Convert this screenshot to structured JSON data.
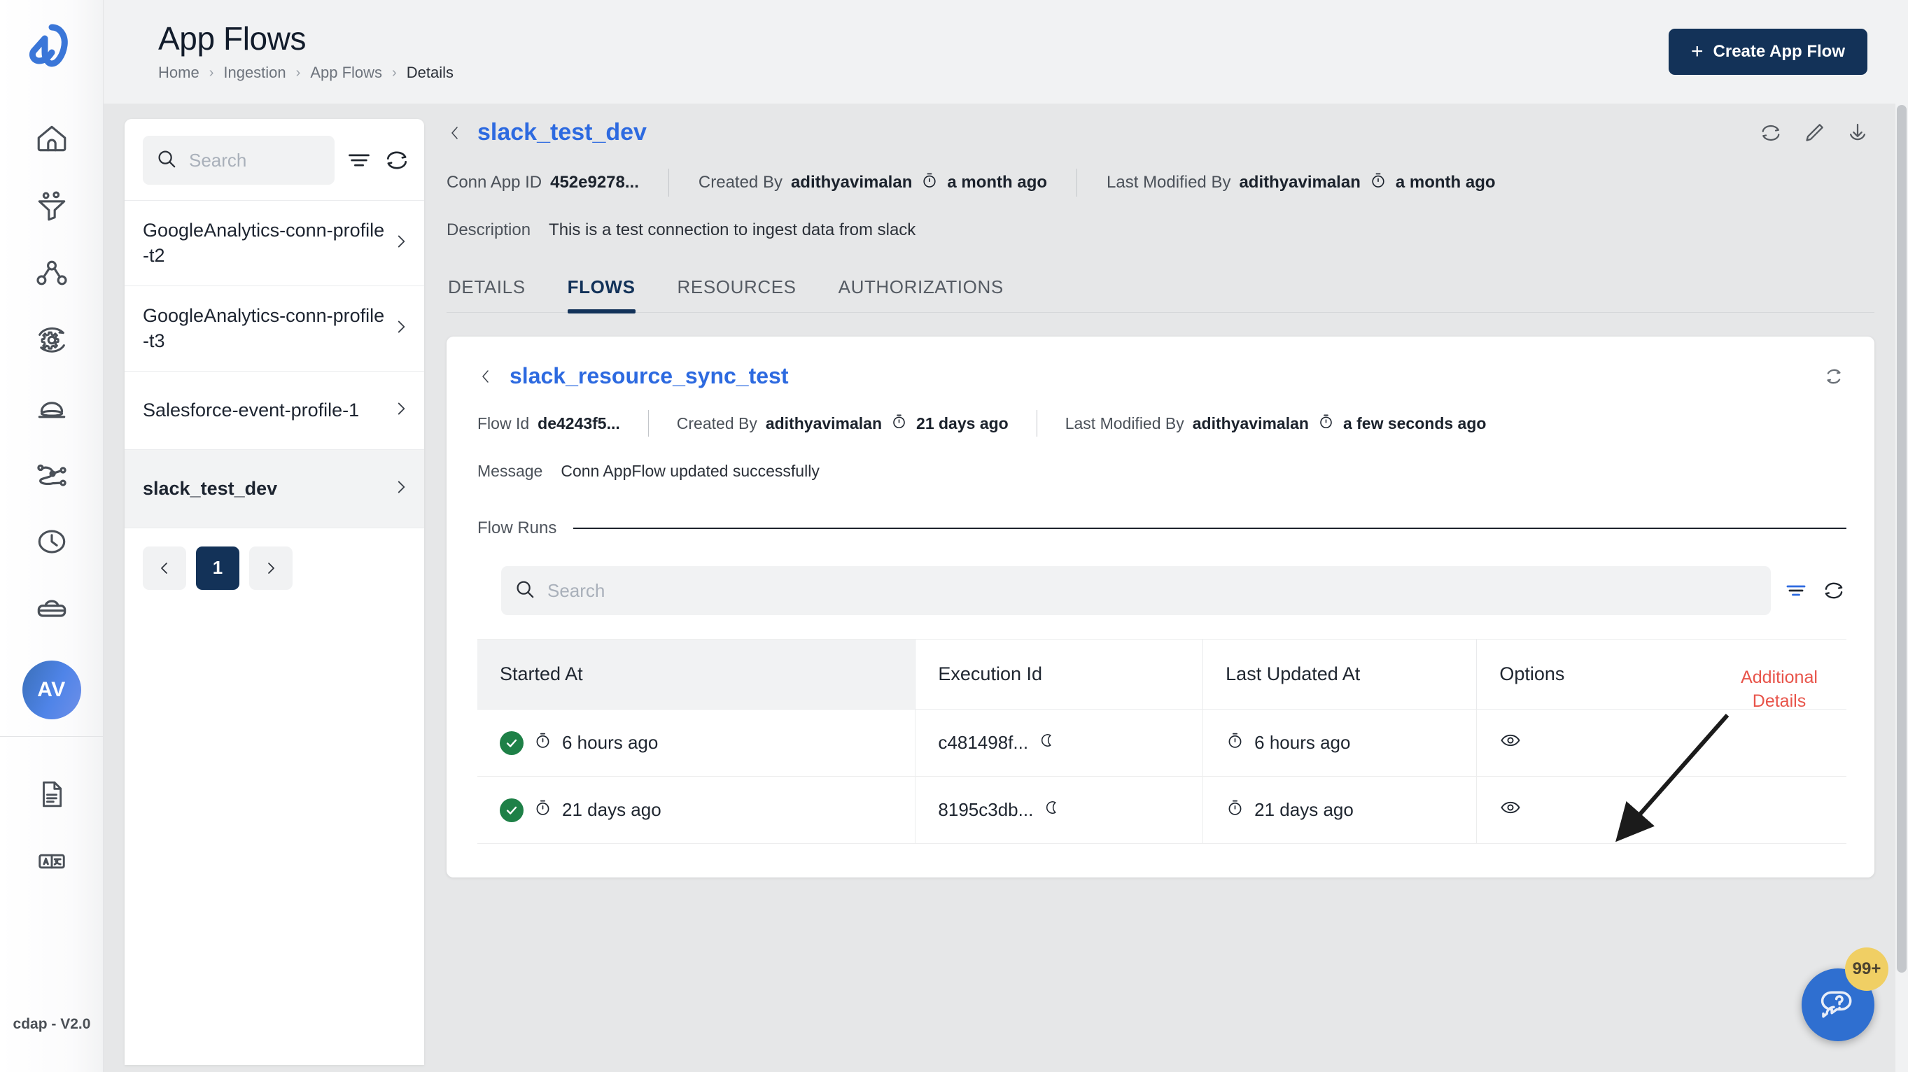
{
  "rail": {
    "logo_name": "cdap-logo",
    "items": [
      {
        "name": "home-icon",
        "label": "Home"
      },
      {
        "name": "funnel-icon",
        "label": "Ingestion"
      },
      {
        "name": "network-nodes-icon",
        "label": "Pipelines"
      },
      {
        "name": "gear-refresh-icon",
        "label": "Processing"
      },
      {
        "name": "dome-icon",
        "label": "Insights"
      },
      {
        "name": "flow-connections-icon",
        "label": "Connections"
      },
      {
        "name": "clock-icon",
        "label": "Schedules"
      },
      {
        "name": "briefcase-icon",
        "label": "Workspace"
      }
    ],
    "avatar_initials": "AV",
    "bottom_items": [
      {
        "name": "document-icon",
        "label": "Docs"
      },
      {
        "name": "translate-icon",
        "label": "Language"
      }
    ],
    "version": "cdap - V2.0"
  },
  "topbar": {
    "title": "App Flows",
    "breadcrumbs": [
      "Home",
      "Ingestion",
      "App Flows",
      "Details"
    ],
    "breadcrumb_separator": "›",
    "create_button": "Create App Flow",
    "create_button_plus": "+",
    "create_button_color": "#133258"
  },
  "list_panel": {
    "search_placeholder": "Search",
    "search_value": "",
    "items": [
      {
        "label": "GoogleAnalytics-conn-profile-t2",
        "selected": false
      },
      {
        "label": "GoogleAnalytics-conn-profile-t3",
        "selected": false
      },
      {
        "label": "Salesforce-event-profile-1",
        "selected": false
      },
      {
        "label": "slack_test_dev",
        "selected": true
      }
    ],
    "pagination": {
      "prev": "‹",
      "current": "1",
      "next": "›"
    }
  },
  "detail": {
    "title": "slack_test_dev",
    "title_color": "#2d6ae0",
    "meta": {
      "conn_app_id_label": "Conn App ID",
      "conn_app_id_value": "452e9278...",
      "created_by_label": "Created By",
      "created_by_user": "adithyavimalan",
      "created_by_time": "a month ago",
      "last_modified_label": "Last Modified By",
      "last_modified_user": "adithyavimalan",
      "last_modified_time": "a month ago"
    },
    "description_label": "Description",
    "description_value": "This is a test connection to ingest data from slack",
    "actions": [
      {
        "name": "refresh-icon"
      },
      {
        "name": "edit-pencil-icon"
      },
      {
        "name": "download-icon"
      }
    ],
    "tabs": [
      {
        "label": "DETAILS",
        "active": false
      },
      {
        "label": "FLOWS",
        "active": true
      },
      {
        "label": "RESOURCES",
        "active": false
      },
      {
        "label": "AUTHORIZATIONS",
        "active": false
      }
    ]
  },
  "flow_card": {
    "title": "slack_resource_sync_test",
    "meta": {
      "flow_id_label": "Flow Id",
      "flow_id_value": "de4243f5...",
      "created_by_label": "Created By",
      "created_by_user": "adithyavimalan",
      "created_by_time": "21 days ago",
      "last_modified_label": "Last Modified By",
      "last_modified_user": "adithyavimalan",
      "last_modified_time": "a few seconds ago"
    },
    "message_label": "Message",
    "message_value": "Conn AppFlow updated successfully",
    "flow_runs_label": "Flow Runs",
    "runs_search_placeholder": "Search",
    "runs_search_value": "",
    "table": {
      "columns": [
        "Started At",
        "Execution Id",
        "Last Updated At",
        "Options"
      ],
      "rows": [
        {
          "status": "success",
          "started_at": "6 hours ago",
          "execution_id": "c481498f...",
          "last_updated_at": "6 hours ago",
          "option_icon": "eye-icon"
        },
        {
          "status": "success",
          "started_at": "21 days ago",
          "execution_id": "8195c3db...",
          "last_updated_at": "21 days ago",
          "option_icon": "eye-icon"
        }
      ]
    }
  },
  "annotation": {
    "text_line1": "Additional",
    "text_line2": "Details",
    "color": "#e8544a"
  },
  "help": {
    "badge_count": "99+",
    "badge_color": "#f0cf64",
    "fab_color": "#2f6fd0"
  }
}
